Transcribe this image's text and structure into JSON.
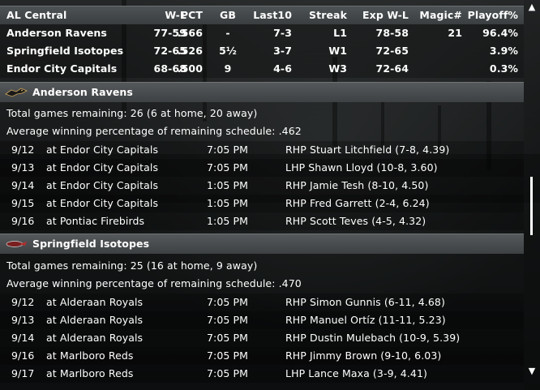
{
  "standings": {
    "header": {
      "division": "AL Central",
      "wl": "W-L",
      "pct": "PCT",
      "gb": "GB",
      "last10": "Last10",
      "streak": "Streak",
      "exp_wl": "Exp W-L",
      "magic": "Magic#",
      "playoff": "Playoff%"
    },
    "rows": [
      {
        "team": "Anderson Ravens",
        "wl": "77-59",
        "pct": ".566",
        "gb": "-",
        "last10": "7-3",
        "streak": "L1",
        "exp_wl": "78-58",
        "magic": "21",
        "playoff": "96.4%"
      },
      {
        "team": "Springfield Isotopes",
        "wl": "72-65",
        "pct": ".526",
        "gb": "5½",
        "last10": "3-7",
        "streak": "W1",
        "exp_wl": "72-65",
        "magic": "",
        "playoff": "3.9%"
      },
      {
        "team": "Endor City Capitals",
        "wl": "68-68",
        "pct": ".500",
        "gb": "9",
        "last10": "4-6",
        "streak": "W3",
        "exp_wl": "72-64",
        "magic": "",
        "playoff": "0.3%"
      }
    ]
  },
  "schedules": [
    {
      "team": "Anderson Ravens",
      "logo_icon": "raven-logo-icon",
      "remaining": "Total games remaining: 26 (6 at home, 20 away)",
      "avg_pct": "Average winning percentage of remaining schedule: .462",
      "games": [
        {
          "date": "9/12",
          "opponent": "at Endor City Capitals",
          "time": "7:05 PM",
          "pitcher": "RHP Stuart Litchfield (7-8, 4.39)"
        },
        {
          "date": "9/13",
          "opponent": "at Endor City Capitals",
          "time": "7:05 PM",
          "pitcher": "LHP Shawn Lloyd (10-8, 3.60)"
        },
        {
          "date": "9/14",
          "opponent": "at Endor City Capitals",
          "time": "1:05 PM",
          "pitcher": "RHP Jamie Tesh (8-10, 4.50)"
        },
        {
          "date": "9/15",
          "opponent": "at Endor City Capitals",
          "time": "1:05 PM",
          "pitcher": "RHP Fred Garrett (2-4, 6.24)"
        },
        {
          "date": "9/16",
          "opponent": "at Pontiac Firebirds",
          "time": "1:05 PM",
          "pitcher": "RHP Scott Teves (4-5, 4.32)"
        }
      ]
    },
    {
      "team": "Springfield Isotopes",
      "logo_icon": "isotopes-logo-icon",
      "remaining": "Total games remaining: 25 (16 at home, 9 away)",
      "avg_pct": "Average winning percentage of remaining schedule: .470",
      "games": [
        {
          "date": "9/12",
          "opponent": "at Alderaan Royals",
          "time": "7:05 PM",
          "pitcher": "RHP Simon Gunnis (6-11, 4.68)"
        },
        {
          "date": "9/13",
          "opponent": "at Alderaan Royals",
          "time": "7:05 PM",
          "pitcher": "RHP Manuel Ortíz (11-11, 5.23)"
        },
        {
          "date": "9/14",
          "opponent": "at Alderaan Royals",
          "time": "7:05 PM",
          "pitcher": "RHP Dustin Mulebach (10-9, 5.39)"
        },
        {
          "date": "9/16",
          "opponent": "at Marlboro Reds",
          "time": "7:05 PM",
          "pitcher": "RHP Jimmy Brown (9-10, 6.03)"
        },
        {
          "date": "9/17",
          "opponent": "at Marlboro Reds",
          "time": "7:05 PM",
          "pitcher": "LHP Lance Maxa (3-9, 4.41)"
        }
      ]
    }
  ],
  "scrollbar": {
    "up_icon": "arrow-up-icon",
    "down_icon": "arrow-down-icon"
  },
  "colors": {
    "header_bg": "#4a4e50",
    "row_dark": "#1f2324",
    "text": "#ffffff"
  }
}
